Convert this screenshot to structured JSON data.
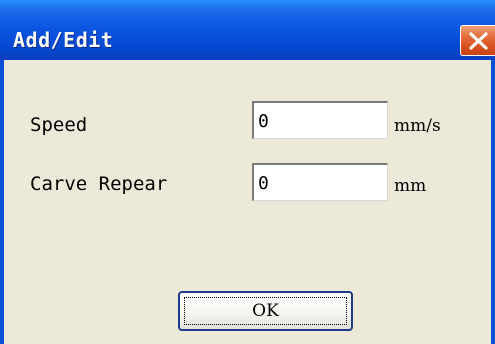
{
  "dialog": {
    "title": "Add/Edit",
    "close_icon": "close-icon"
  },
  "form": {
    "speed": {
      "label": "Speed",
      "value": "0",
      "unit": "mm/s"
    },
    "carve_repeat": {
      "label": "Carve Repear",
      "value": "0",
      "unit": "mm"
    }
  },
  "buttons": {
    "ok_label": "OK"
  },
  "colors": {
    "titlebar": "#0A54E0",
    "close_button": "#D8501E",
    "dialog_background": "#ECE9D8"
  }
}
